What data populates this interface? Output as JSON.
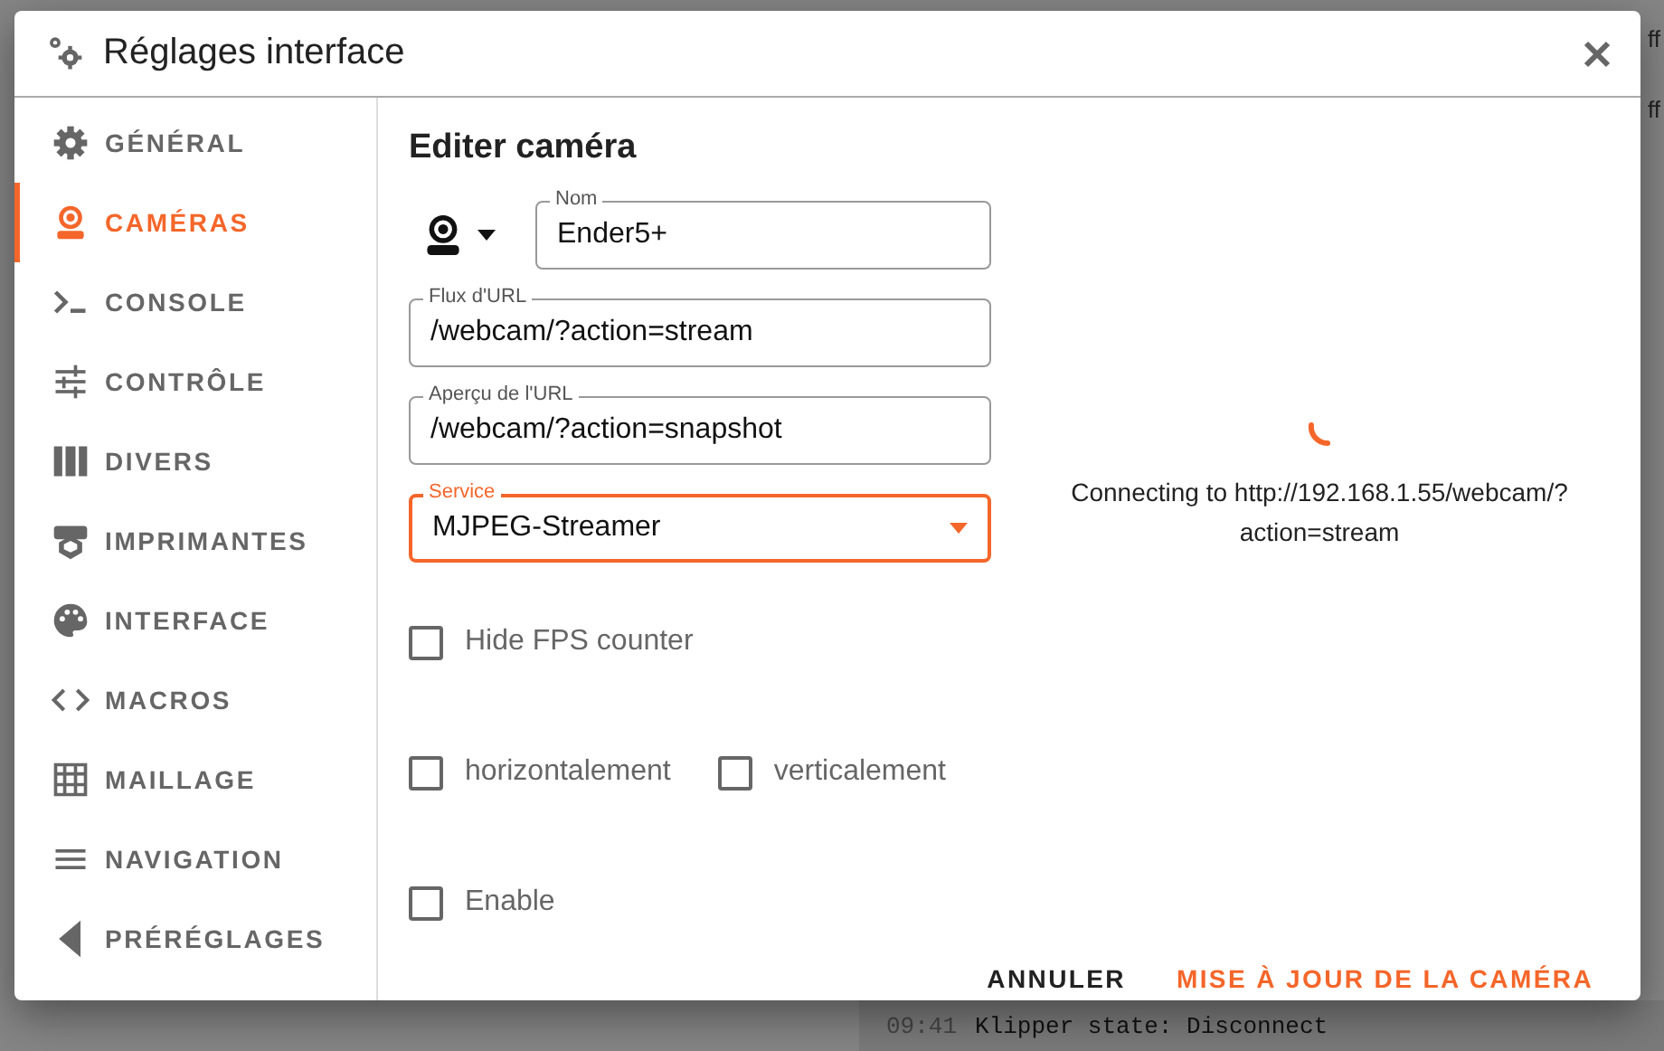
{
  "background": {
    "side_texts": [
      "ff",
      "ff"
    ],
    "console_line": {
      "time": "09:41",
      "message": "Klipper state: Disconnect"
    }
  },
  "dialog": {
    "title": "Réglages interface"
  },
  "sidebar": {
    "items": [
      {
        "label": "GÉNÉRAL",
        "selected": false
      },
      {
        "label": "CAMÉRAS",
        "selected": true
      },
      {
        "label": "CONSOLE",
        "selected": false
      },
      {
        "label": "CONTRÔLE",
        "selected": false
      },
      {
        "label": "DIVERS",
        "selected": false
      },
      {
        "label": "IMPRIMANTES",
        "selected": false
      },
      {
        "label": "INTERFACE",
        "selected": false
      },
      {
        "label": "MACROS",
        "selected": false
      },
      {
        "label": "MAILLAGE",
        "selected": false
      },
      {
        "label": "NAVIGATION",
        "selected": false
      },
      {
        "label": "PRÉRÉGLAGES",
        "selected": false
      }
    ]
  },
  "form": {
    "heading": "Editer caméra",
    "name_field": {
      "label": "Nom",
      "value": "Ender5+"
    },
    "url_fields": [
      {
        "label": "Flux d'URL",
        "value": "/webcam/?action=stream"
      },
      {
        "label": "Aperçu de l'URL",
        "value": "/webcam/?action=snapshot"
      }
    ],
    "service_select": {
      "label": "Service",
      "value": "MJPEG-Streamer",
      "focused": true
    },
    "checkbox_rows": [
      {
        "items": [
          {
            "label": "Hide FPS counter",
            "checked": false
          }
        ]
      },
      {
        "items": [
          {
            "label": "horizontalement",
            "checked": false
          },
          {
            "label": "verticalement",
            "checked": false
          }
        ]
      },
      {
        "items": [
          {
            "label": "Enable",
            "checked": false
          }
        ]
      }
    ]
  },
  "preview": {
    "status": "Connecting to http://192.168.1.55/webcam/?action=stream"
  },
  "actions": [
    {
      "label": "ANNULER",
      "kind": "text"
    },
    {
      "label": "MISE À JOUR DE LA CAMÉRA",
      "kind": "primary"
    }
  ]
}
